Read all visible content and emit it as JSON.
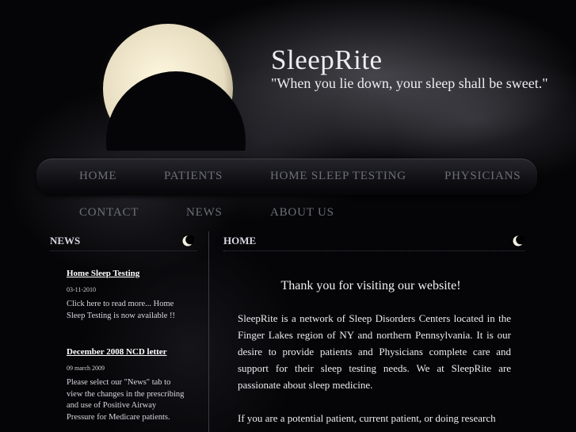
{
  "header": {
    "title": "SleepRite",
    "tagline": "\"When you lie down, your sleep shall be sweet.\""
  },
  "nav": {
    "items": [
      "HOME",
      "PATIENTS",
      "HOME SLEEP TESTING",
      "PHYSICIANS",
      "CONTACT",
      "NEWS",
      "ABOUT US"
    ]
  },
  "sidebar": {
    "heading": "NEWS",
    "news": [
      {
        "title": "Home Sleep Testing",
        "date": "03-11-2010",
        "body": "Click here to read more... Home Sleep Testing is now available !!"
      },
      {
        "title": "December 2008 NCD letter",
        "date": "09 march 2009",
        "body": "Please select our \"News\" tab to view the changes in the prescribing and use of Positive Airway Pressure for Medicare patients."
      }
    ]
  },
  "main": {
    "heading": "HOME",
    "welcome": "Thank you for visiting our website!",
    "paragraphs": [
      "SleepRite is a network of Sleep Disorders Centers located in the Finger Lakes region of NY and northern Pennsylvania. It is our desire to provide patients and Physicians complete care and support for their sleep testing needs. We at SleepRite are passionate about sleep medicine.",
      "If you are a potential patient, current patient, or doing research"
    ]
  },
  "colors": {
    "background": "#000000",
    "nav_text": "#6d6f7a",
    "text": "#ececf0"
  }
}
